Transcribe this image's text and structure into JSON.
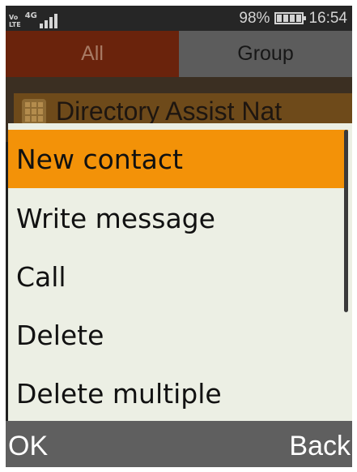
{
  "status_bar": {
    "volte_top": "Vo",
    "volte_bottom": "LTE",
    "network": "4G",
    "battery_percent": "98%",
    "battery_level": 0.98,
    "time": "16:54"
  },
  "tabs": [
    {
      "label": "All",
      "selected": true
    },
    {
      "label": "Group",
      "selected": false
    }
  ],
  "contact_list": {
    "first_contact": "Directory Assist Nat"
  },
  "options_menu": {
    "items": [
      {
        "label": "New contact",
        "selected": true
      },
      {
        "label": "Write message",
        "selected": false
      },
      {
        "label": "Call",
        "selected": false
      },
      {
        "label": "Delete",
        "selected": false
      },
      {
        "label": "Delete multiple",
        "selected": false
      }
    ]
  },
  "softkeys": {
    "left": "OK",
    "right": "Back"
  },
  "colors": {
    "highlight": "#f39208",
    "menu_background": "#ecefe4",
    "tab_all_active": "#6a230c"
  }
}
